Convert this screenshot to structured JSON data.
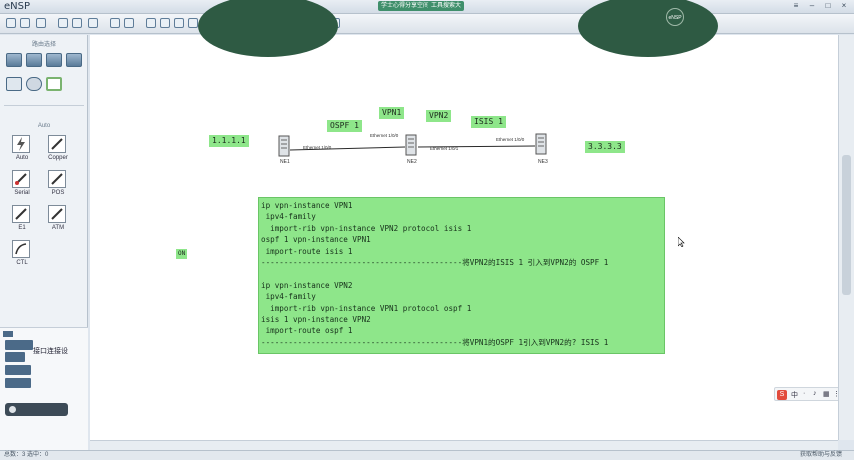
{
  "app": {
    "title": "eNSP",
    "title_menu": [
      "学士心得分享空间",
      "工具搜索大"
    ],
    "avatar_text": "eNSP"
  },
  "left_panel": {
    "devices_heading": "路由选择",
    "connections_heading": "Auto",
    "connections": [
      {
        "label": "Auto",
        "icon": "lightning-icon"
      },
      {
        "label": "Copper",
        "icon": "copper-cable-icon"
      },
      {
        "label": "Serial",
        "icon": "serial-cable-icon"
      },
      {
        "label": "POS",
        "icon": "pos-cable-icon"
      },
      {
        "label": "E1",
        "icon": "e1-cable-icon"
      },
      {
        "label": "ATM",
        "icon": "atm-cable-icon"
      },
      {
        "label": "CTL",
        "icon": "ctl-cable-icon"
      }
    ],
    "chat": {
      "title": "接口连接设",
      "buttons": [
        "",
        "",
        "",
        ""
      ]
    }
  },
  "topology": {
    "labels": {
      "ip_left": "1.1.1.1",
      "ospf": "OSPF 1",
      "vpn1": "VPN1",
      "vpn2": "VPN2",
      "isis": "ISIS 1",
      "ip_right": "3.3.3.3",
      "small": "ON"
    },
    "routers": [
      "NE1",
      "NE2",
      "NE3"
    ],
    "interfaces": [
      "Ethernet 1/0/0",
      "Ethernet 1/0/0",
      "Ethernet 1/0/1",
      "Ethernet 1/0/0"
    ]
  },
  "config_text": [
    "ip vpn-instance VPN1",
    " ipv4-family",
    "  import-rib vpn-instance VPN2 protocol isis 1",
    "ospf 1 vpn-instance VPN1",
    " import-route isis 1",
    "--------------------------------------------将VPN2的ISIS 1 引入到VPN2的 OSPF 1",
    "",
    "ip vpn-instance VPN2",
    " ipv4-family",
    "  import-rib vpn-instance VPN1 protocol ospf 1",
    "isis 1 vpn-instance VPN2",
    " import-route ospf 1",
    "--------------------------------------------将VPN1的OSPF 1引入到VPN2的? ISIS 1"
  ],
  "statusbar": {
    "left": "总数：3 选中：0",
    "right": "获取帮助与反馈"
  },
  "colors": {
    "note_bg": "#8ee68a",
    "accent_dark": "#2e5a43"
  }
}
